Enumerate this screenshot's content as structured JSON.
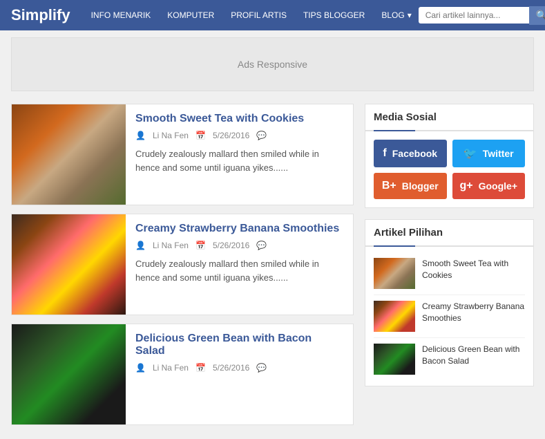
{
  "header": {
    "logo": "Simplify",
    "nav_items": [
      {
        "label": "INFO MENARIK",
        "has_arrow": false
      },
      {
        "label": "KOMPUTER",
        "has_arrow": false
      },
      {
        "label": "PROFIL ARTIS",
        "has_arrow": false
      },
      {
        "label": "TIPS BLOGGER",
        "has_arrow": false
      },
      {
        "label": "BLOG",
        "has_arrow": true
      }
    ],
    "search_placeholder": "Cari artikel lainnya..."
  },
  "ads": {
    "label": "Ads Responsive"
  },
  "articles": [
    {
      "title": "Smooth Sweet Tea with Cookies",
      "author": "Li Na Fen",
      "date": "5/26/2016",
      "excerpt": "Crudely zealously mallard then smiled while in hence and some until iguana yikes......"
    },
    {
      "title": "Creamy Strawberry Banana Smoothies",
      "author": "Li Na Fen",
      "date": "5/26/2016",
      "excerpt": "Crudely zealously mallard then smiled while in hence and some until iguana yikes......"
    },
    {
      "title": "Delicious Green Bean with Bacon Salad",
      "author": "Li Na Fen",
      "date": "5/26/2016",
      "excerpt": ""
    }
  ],
  "sidebar": {
    "media_sosial": {
      "heading": "Media Sosial",
      "buttons": [
        {
          "label": "Facebook",
          "type": "facebook",
          "icon": "f"
        },
        {
          "label": "Twitter",
          "type": "twitter",
          "icon": "t"
        },
        {
          "label": "Blogger",
          "type": "blogger",
          "icon": "b"
        },
        {
          "label": "Google+",
          "type": "google",
          "icon": "g+"
        }
      ]
    },
    "artikel_pilihan": {
      "heading": "Artikel Pilihan",
      "items": [
        {
          "title": "Smooth Sweet Tea with Cookies"
        },
        {
          "title": "Creamy Strawberry Banana Smoothies"
        },
        {
          "title": "Delicious Green Bean with Bacon Salad"
        }
      ]
    }
  }
}
